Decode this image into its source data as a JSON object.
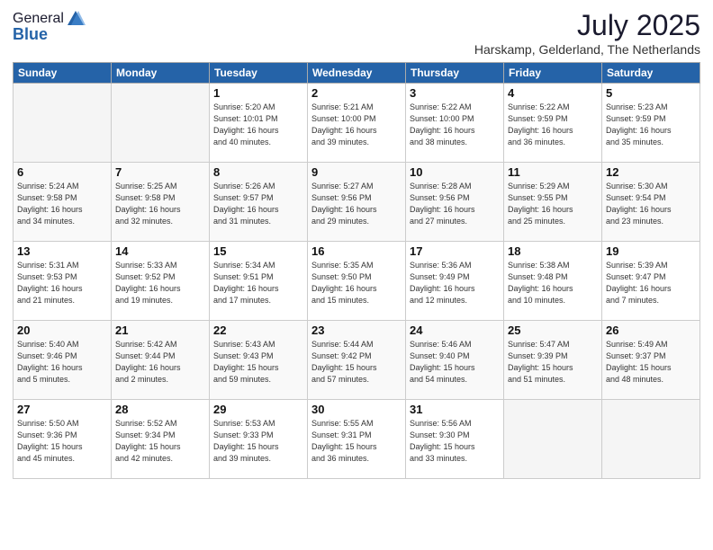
{
  "header": {
    "logo_general": "General",
    "logo_blue": "Blue",
    "month_year": "July 2025",
    "location": "Harskamp, Gelderland, The Netherlands"
  },
  "weekdays": [
    "Sunday",
    "Monday",
    "Tuesday",
    "Wednesday",
    "Thursday",
    "Friday",
    "Saturday"
  ],
  "weeks": [
    [
      {
        "day": "",
        "info": ""
      },
      {
        "day": "",
        "info": ""
      },
      {
        "day": "1",
        "info": "Sunrise: 5:20 AM\nSunset: 10:01 PM\nDaylight: 16 hours\nand 40 minutes."
      },
      {
        "day": "2",
        "info": "Sunrise: 5:21 AM\nSunset: 10:00 PM\nDaylight: 16 hours\nand 39 minutes."
      },
      {
        "day": "3",
        "info": "Sunrise: 5:22 AM\nSunset: 10:00 PM\nDaylight: 16 hours\nand 38 minutes."
      },
      {
        "day": "4",
        "info": "Sunrise: 5:22 AM\nSunset: 9:59 PM\nDaylight: 16 hours\nand 36 minutes."
      },
      {
        "day": "5",
        "info": "Sunrise: 5:23 AM\nSunset: 9:59 PM\nDaylight: 16 hours\nand 35 minutes."
      }
    ],
    [
      {
        "day": "6",
        "info": "Sunrise: 5:24 AM\nSunset: 9:58 PM\nDaylight: 16 hours\nand 34 minutes."
      },
      {
        "day": "7",
        "info": "Sunrise: 5:25 AM\nSunset: 9:58 PM\nDaylight: 16 hours\nand 32 minutes."
      },
      {
        "day": "8",
        "info": "Sunrise: 5:26 AM\nSunset: 9:57 PM\nDaylight: 16 hours\nand 31 minutes."
      },
      {
        "day": "9",
        "info": "Sunrise: 5:27 AM\nSunset: 9:56 PM\nDaylight: 16 hours\nand 29 minutes."
      },
      {
        "day": "10",
        "info": "Sunrise: 5:28 AM\nSunset: 9:56 PM\nDaylight: 16 hours\nand 27 minutes."
      },
      {
        "day": "11",
        "info": "Sunrise: 5:29 AM\nSunset: 9:55 PM\nDaylight: 16 hours\nand 25 minutes."
      },
      {
        "day": "12",
        "info": "Sunrise: 5:30 AM\nSunset: 9:54 PM\nDaylight: 16 hours\nand 23 minutes."
      }
    ],
    [
      {
        "day": "13",
        "info": "Sunrise: 5:31 AM\nSunset: 9:53 PM\nDaylight: 16 hours\nand 21 minutes."
      },
      {
        "day": "14",
        "info": "Sunrise: 5:33 AM\nSunset: 9:52 PM\nDaylight: 16 hours\nand 19 minutes."
      },
      {
        "day": "15",
        "info": "Sunrise: 5:34 AM\nSunset: 9:51 PM\nDaylight: 16 hours\nand 17 minutes."
      },
      {
        "day": "16",
        "info": "Sunrise: 5:35 AM\nSunset: 9:50 PM\nDaylight: 16 hours\nand 15 minutes."
      },
      {
        "day": "17",
        "info": "Sunrise: 5:36 AM\nSunset: 9:49 PM\nDaylight: 16 hours\nand 12 minutes."
      },
      {
        "day": "18",
        "info": "Sunrise: 5:38 AM\nSunset: 9:48 PM\nDaylight: 16 hours\nand 10 minutes."
      },
      {
        "day": "19",
        "info": "Sunrise: 5:39 AM\nSunset: 9:47 PM\nDaylight: 16 hours\nand 7 minutes."
      }
    ],
    [
      {
        "day": "20",
        "info": "Sunrise: 5:40 AM\nSunset: 9:46 PM\nDaylight: 16 hours\nand 5 minutes."
      },
      {
        "day": "21",
        "info": "Sunrise: 5:42 AM\nSunset: 9:44 PM\nDaylight: 16 hours\nand 2 minutes."
      },
      {
        "day": "22",
        "info": "Sunrise: 5:43 AM\nSunset: 9:43 PM\nDaylight: 15 hours\nand 59 minutes."
      },
      {
        "day": "23",
        "info": "Sunrise: 5:44 AM\nSunset: 9:42 PM\nDaylight: 15 hours\nand 57 minutes."
      },
      {
        "day": "24",
        "info": "Sunrise: 5:46 AM\nSunset: 9:40 PM\nDaylight: 15 hours\nand 54 minutes."
      },
      {
        "day": "25",
        "info": "Sunrise: 5:47 AM\nSunset: 9:39 PM\nDaylight: 15 hours\nand 51 minutes."
      },
      {
        "day": "26",
        "info": "Sunrise: 5:49 AM\nSunset: 9:37 PM\nDaylight: 15 hours\nand 48 minutes."
      }
    ],
    [
      {
        "day": "27",
        "info": "Sunrise: 5:50 AM\nSunset: 9:36 PM\nDaylight: 15 hours\nand 45 minutes."
      },
      {
        "day": "28",
        "info": "Sunrise: 5:52 AM\nSunset: 9:34 PM\nDaylight: 15 hours\nand 42 minutes."
      },
      {
        "day": "29",
        "info": "Sunrise: 5:53 AM\nSunset: 9:33 PM\nDaylight: 15 hours\nand 39 minutes."
      },
      {
        "day": "30",
        "info": "Sunrise: 5:55 AM\nSunset: 9:31 PM\nDaylight: 15 hours\nand 36 minutes."
      },
      {
        "day": "31",
        "info": "Sunrise: 5:56 AM\nSunset: 9:30 PM\nDaylight: 15 hours\nand 33 minutes."
      },
      {
        "day": "",
        "info": ""
      },
      {
        "day": "",
        "info": ""
      }
    ]
  ]
}
